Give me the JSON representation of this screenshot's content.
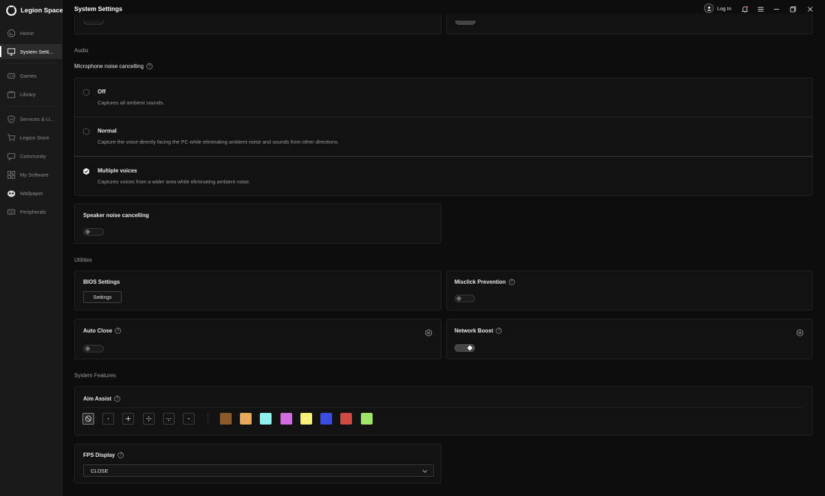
{
  "app": {
    "name": "Legion Space"
  },
  "sidebar": {
    "items": [
      {
        "label": "Home",
        "icon": "home-icon"
      },
      {
        "label": "System Setti...",
        "icon": "monitor-icon",
        "active": true
      },
      {
        "label": "Games",
        "icon": "gamepad-icon"
      },
      {
        "label": "Library",
        "icon": "library-icon"
      },
      {
        "label": "Services & U...",
        "icon": "shield-check-icon"
      },
      {
        "label": "Legion Store",
        "icon": "cart-icon"
      },
      {
        "label": "Community",
        "icon": "chat-icon"
      },
      {
        "label": "My Software",
        "icon": "apps-icon"
      },
      {
        "label": "Wallpaper",
        "icon": "wallpaper-icon"
      },
      {
        "label": "Peripherals",
        "icon": "peripherals-icon"
      }
    ]
  },
  "header": {
    "title": "System Settings",
    "login_label": "Log In"
  },
  "audio": {
    "section_title": "Audio",
    "mic_title": "Microphone noise cancelling",
    "options": [
      {
        "label": "Off",
        "description": "Captures all ambient sounds.",
        "selected": false
      },
      {
        "label": "Normal",
        "description": "Capture the voice directly facing the PC while eliminating ambient noise and sounds from other directions.",
        "selected": false
      },
      {
        "label": "Multiple voices",
        "description": "Captures voices from a wider area while eliminating ambient noise.",
        "selected": true
      }
    ],
    "speaker_title": "Speaker noise cancelling",
    "speaker_on": false
  },
  "utilities": {
    "section_title": "Utilities",
    "bios_title": "BIOS Settings",
    "bios_button": "Settings",
    "misclick_title": "Misclick Prevention",
    "misclick_on": false,
    "autoclose_title": "Auto Close",
    "autoclose_on": false,
    "networkboost_title": "Network Boost",
    "networkboost_on": true
  },
  "system_features": {
    "section_title": "System Features",
    "aim_title": "Aim Assist",
    "crosshairs": [
      "none-icon",
      "dot-crosshair-icon",
      "plus-crosshair-icon",
      "gap-crosshair-icon",
      "spread-crosshair-icon",
      "dash-crosshair-icon"
    ],
    "colors": [
      "#8a5a2b",
      "#e8a95a",
      "#8ff0f0",
      "#d16be0",
      "#f5f07a",
      "#3b4de0",
      "#d04a44",
      "#9ee56a"
    ],
    "fps_title": "FPS Display",
    "fps_value": "CLOSE"
  },
  "colors": {
    "background": "#0d0d0d",
    "card": "#121212",
    "sidebar": "#1a1a1a"
  }
}
